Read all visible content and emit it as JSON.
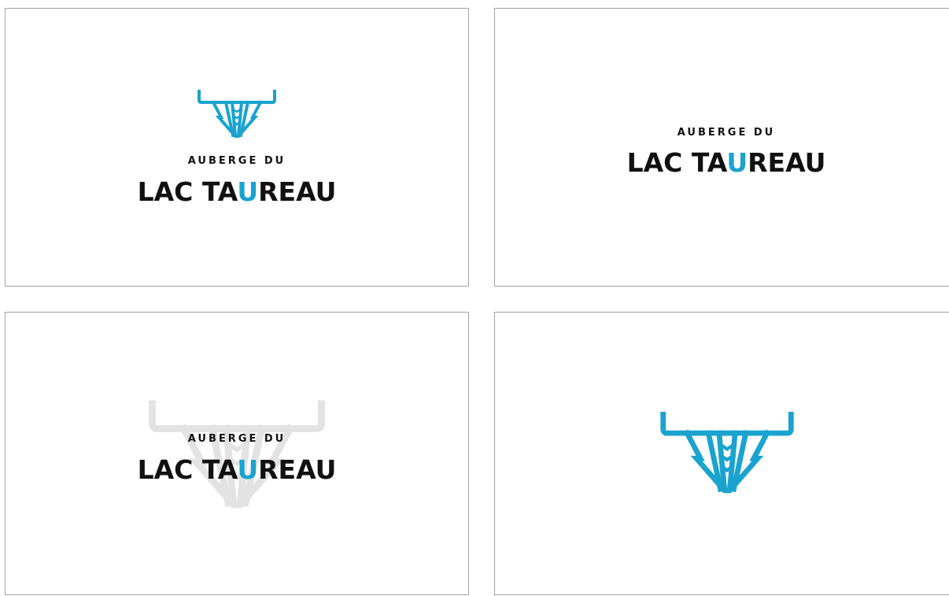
{
  "brand": {
    "tagline": "AUBERGE DU",
    "name_part_1": "LAC TA",
    "name_highlight": "U",
    "name_part_2": "REAU"
  },
  "colors": {
    "accent": "#1aa3cf",
    "text": "#111111",
    "watermark": "#e3e3e3",
    "card_border": "#a3a3a3"
  },
  "panels": [
    {
      "variant": "icon-above-wordmark"
    },
    {
      "variant": "wordmark-only"
    },
    {
      "variant": "wordmark-over-watermark"
    },
    {
      "variant": "icon-only"
    }
  ]
}
